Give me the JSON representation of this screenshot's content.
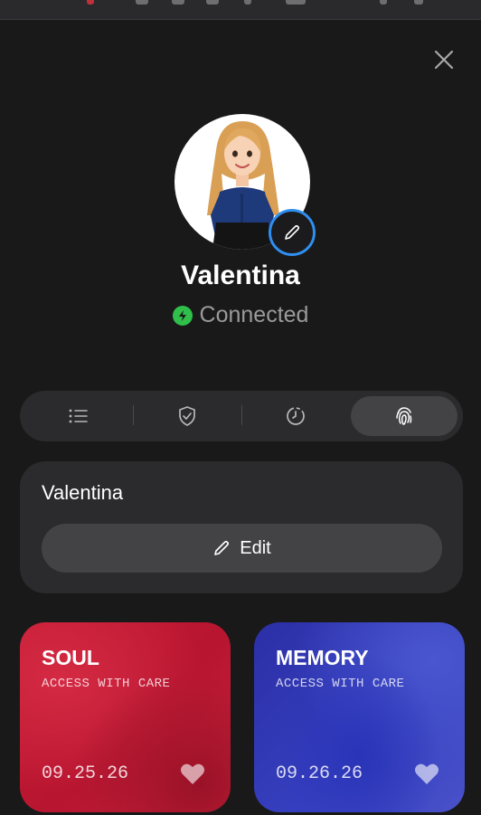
{
  "close": {
    "icon": "close-icon"
  },
  "profile": {
    "name": "Valentina",
    "status": "Connected",
    "status_color": "#2fbf4a",
    "edit_ring_color": "#2f8ff0"
  },
  "tabs": [
    {
      "icon": "list-icon",
      "active": false
    },
    {
      "icon": "shield-check-icon",
      "active": false
    },
    {
      "icon": "clock-dashed-icon",
      "active": false
    },
    {
      "icon": "fingerprint-icon",
      "active": true
    }
  ],
  "info_card": {
    "name": "Valentina",
    "edit_label": "Edit"
  },
  "cards": [
    {
      "title": "SOUL",
      "subtitle": "ACCESS WITH CARE",
      "date": "09.25.26",
      "color": "#c81c35"
    },
    {
      "title": "MEMORY",
      "subtitle": "ACCESS WITH CARE",
      "date": "09.26.26",
      "color": "#3640c0"
    }
  ]
}
